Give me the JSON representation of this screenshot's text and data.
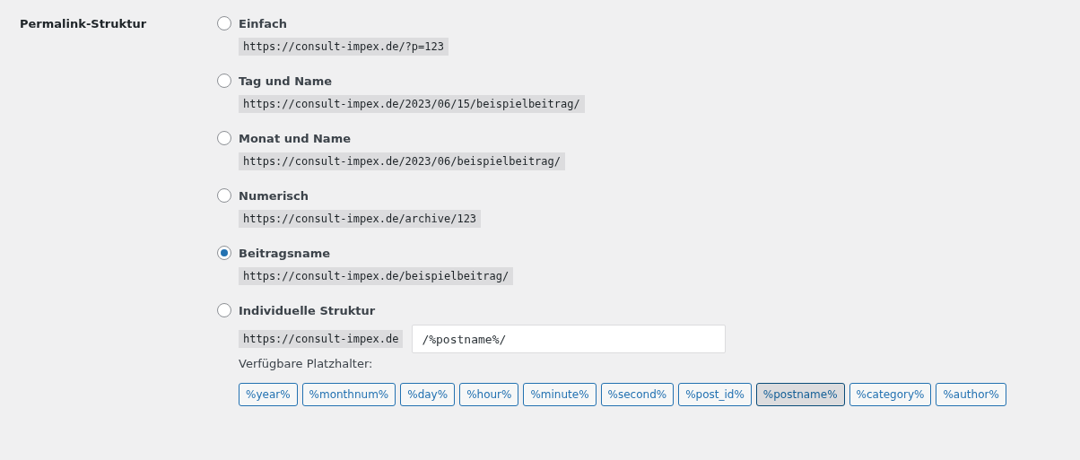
{
  "label": "Permalink-Struktur",
  "options": [
    {
      "label": "Einfach",
      "selected": false,
      "example": "https://consult-impex.de/?p=123"
    },
    {
      "label": "Tag und Name",
      "selected": false,
      "example": "https://consult-impex.de/2023/06/15/beispielbeitrag/"
    },
    {
      "label": "Monat und Name",
      "selected": false,
      "example": "https://consult-impex.de/2023/06/beispielbeitrag/"
    },
    {
      "label": "Numerisch",
      "selected": false,
      "example": "https://consult-impex.de/archive/123"
    },
    {
      "label": "Beitragsname",
      "selected": true,
      "example": "https://consult-impex.de/beispielbeitrag/"
    },
    {
      "label": "Individuelle Struktur",
      "selected": false,
      "prefix": "https://consult-impex.de",
      "value": "/%postname%/"
    }
  ],
  "tags_label": "Verfügbare Platzhalter:",
  "tags": [
    {
      "label": "%year%",
      "selected": false
    },
    {
      "label": "%monthnum%",
      "selected": false
    },
    {
      "label": "%day%",
      "selected": false
    },
    {
      "label": "%hour%",
      "selected": false
    },
    {
      "label": "%minute%",
      "selected": false
    },
    {
      "label": "%second%",
      "selected": false
    },
    {
      "label": "%post_id%",
      "selected": false
    },
    {
      "label": "%postname%",
      "selected": true
    },
    {
      "label": "%category%",
      "selected": false
    },
    {
      "label": "%author%",
      "selected": false
    }
  ]
}
